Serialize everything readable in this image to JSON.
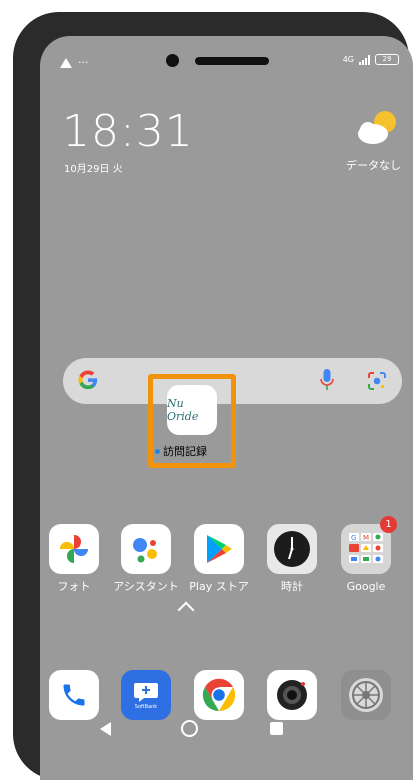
{
  "status": {
    "left_text": "···",
    "network": "4G",
    "battery": "29"
  },
  "clock": {
    "time": "18:31",
    "date": "10月29日 火"
  },
  "weather": {
    "text": "データなし",
    "icon": "partly-cloudy-icon"
  },
  "search": {
    "icons": [
      "google-g-icon",
      "mic-icon",
      "lens-icon"
    ]
  },
  "highlighted_app": {
    "label": "訪問記録",
    "icon_text": "Nu Oride",
    "accent": "#f0920a"
  },
  "apps_row": [
    {
      "label": "フォト",
      "icon": "photos-icon"
    },
    {
      "label": "アシスタント",
      "icon": "assistant-icon"
    },
    {
      "label": "Play ストア",
      "icon": "play-store-icon"
    },
    {
      "label": "時計",
      "icon": "clock-icon"
    },
    {
      "label": "Google",
      "icon": "google-folder-icon",
      "badge": "1"
    }
  ],
  "dock": [
    {
      "icon": "phone-icon"
    },
    {
      "icon": "softbank-icon",
      "text": "SoftBank"
    },
    {
      "icon": "chrome-icon"
    },
    {
      "icon": "camera-icon"
    },
    {
      "icon": "settings-icon"
    }
  ],
  "nav": [
    "back-icon",
    "home-icon",
    "recents-icon"
  ]
}
